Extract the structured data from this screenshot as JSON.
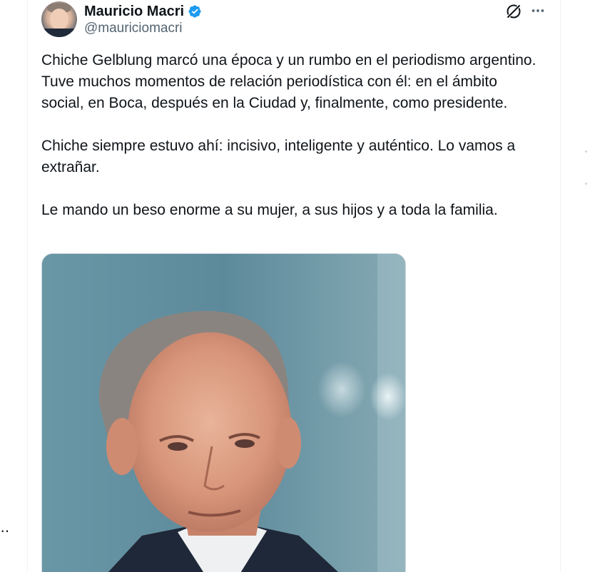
{
  "author": {
    "display_name": "Mauricio Macri",
    "handle": "@mauriciomacri",
    "verified": true,
    "avatar": "profile-photo"
  },
  "tweet": {
    "paragraphs": [
      "Chiche Gelblung marcó una época y un rumbo en el periodismo argentino. Tuve muchos momentos de relación periodística con él: en el ámbito social, en Boca, después en la Ciudad y, finalmente, como presidente.",
      "Chiche siempre estuvo ahí: incisivo, inteligente y auténtico. Lo vamos a extrañar.",
      "Le mando un beso enorme a su mujer, a sus hijos y a toda la familia."
    ],
    "media": {
      "type": "photo",
      "subject": "portrait-of-man-in-suit"
    }
  },
  "icons": {
    "verified": "verified-badge-icon",
    "grok": "grok-icon",
    "more": "more-options-icon"
  },
  "colors": {
    "text_primary": "#0f1419",
    "text_secondary": "#536471",
    "verified_blue": "#1d9bf0",
    "border": "#eff3f4"
  },
  "left_overflow_text": "··"
}
